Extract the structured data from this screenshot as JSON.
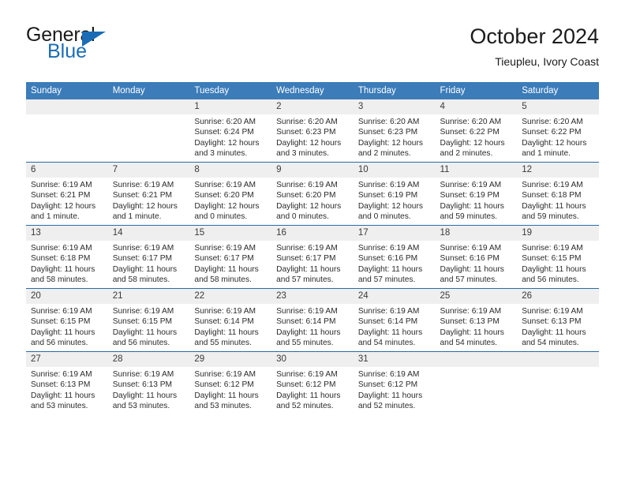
{
  "brand": {
    "name_top": "General",
    "name_bottom": "Blue",
    "color_top": "#1b1b1b",
    "color_bottom": "#1b6cb5",
    "triangle_icon": "triangle-icon"
  },
  "header": {
    "title": "October 2024",
    "subtitle": "Tieupleu, Ivory Coast"
  },
  "theme": {
    "header_bg": "#3b7cb9",
    "row_divider": "#2a6ba8",
    "daynum_bg": "#efefef",
    "text": "#2b2b2b"
  },
  "calendar": {
    "weekday_headers": [
      "Sunday",
      "Monday",
      "Tuesday",
      "Wednesday",
      "Thursday",
      "Friday",
      "Saturday"
    ],
    "weeks": [
      [
        {
          "day": "",
          "empty": true
        },
        {
          "day": "",
          "empty": true
        },
        {
          "day": "1",
          "sunrise": "Sunrise: 6:20 AM",
          "sunset": "Sunset: 6:24 PM",
          "daylight": "Daylight: 12 hours and 3 minutes."
        },
        {
          "day": "2",
          "sunrise": "Sunrise: 6:20 AM",
          "sunset": "Sunset: 6:23 PM",
          "daylight": "Daylight: 12 hours and 3 minutes."
        },
        {
          "day": "3",
          "sunrise": "Sunrise: 6:20 AM",
          "sunset": "Sunset: 6:23 PM",
          "daylight": "Daylight: 12 hours and 2 minutes."
        },
        {
          "day": "4",
          "sunrise": "Sunrise: 6:20 AM",
          "sunset": "Sunset: 6:22 PM",
          "daylight": "Daylight: 12 hours and 2 minutes."
        },
        {
          "day": "5",
          "sunrise": "Sunrise: 6:20 AM",
          "sunset": "Sunset: 6:22 PM",
          "daylight": "Daylight: 12 hours and 1 minute."
        }
      ],
      [
        {
          "day": "6",
          "sunrise": "Sunrise: 6:19 AM",
          "sunset": "Sunset: 6:21 PM",
          "daylight": "Daylight: 12 hours and 1 minute."
        },
        {
          "day": "7",
          "sunrise": "Sunrise: 6:19 AM",
          "sunset": "Sunset: 6:21 PM",
          "daylight": "Daylight: 12 hours and 1 minute."
        },
        {
          "day": "8",
          "sunrise": "Sunrise: 6:19 AM",
          "sunset": "Sunset: 6:20 PM",
          "daylight": "Daylight: 12 hours and 0 minutes."
        },
        {
          "day": "9",
          "sunrise": "Sunrise: 6:19 AM",
          "sunset": "Sunset: 6:20 PM",
          "daylight": "Daylight: 12 hours and 0 minutes."
        },
        {
          "day": "10",
          "sunrise": "Sunrise: 6:19 AM",
          "sunset": "Sunset: 6:19 PM",
          "daylight": "Daylight: 12 hours and 0 minutes."
        },
        {
          "day": "11",
          "sunrise": "Sunrise: 6:19 AM",
          "sunset": "Sunset: 6:19 PM",
          "daylight": "Daylight: 11 hours and 59 minutes."
        },
        {
          "day": "12",
          "sunrise": "Sunrise: 6:19 AM",
          "sunset": "Sunset: 6:18 PM",
          "daylight": "Daylight: 11 hours and 59 minutes."
        }
      ],
      [
        {
          "day": "13",
          "sunrise": "Sunrise: 6:19 AM",
          "sunset": "Sunset: 6:18 PM",
          "daylight": "Daylight: 11 hours and 58 minutes."
        },
        {
          "day": "14",
          "sunrise": "Sunrise: 6:19 AM",
          "sunset": "Sunset: 6:17 PM",
          "daylight": "Daylight: 11 hours and 58 minutes."
        },
        {
          "day": "15",
          "sunrise": "Sunrise: 6:19 AM",
          "sunset": "Sunset: 6:17 PM",
          "daylight": "Daylight: 11 hours and 58 minutes."
        },
        {
          "day": "16",
          "sunrise": "Sunrise: 6:19 AM",
          "sunset": "Sunset: 6:17 PM",
          "daylight": "Daylight: 11 hours and 57 minutes."
        },
        {
          "day": "17",
          "sunrise": "Sunrise: 6:19 AM",
          "sunset": "Sunset: 6:16 PM",
          "daylight": "Daylight: 11 hours and 57 minutes."
        },
        {
          "day": "18",
          "sunrise": "Sunrise: 6:19 AM",
          "sunset": "Sunset: 6:16 PM",
          "daylight": "Daylight: 11 hours and 57 minutes."
        },
        {
          "day": "19",
          "sunrise": "Sunrise: 6:19 AM",
          "sunset": "Sunset: 6:15 PM",
          "daylight": "Daylight: 11 hours and 56 minutes."
        }
      ],
      [
        {
          "day": "20",
          "sunrise": "Sunrise: 6:19 AM",
          "sunset": "Sunset: 6:15 PM",
          "daylight": "Daylight: 11 hours and 56 minutes."
        },
        {
          "day": "21",
          "sunrise": "Sunrise: 6:19 AM",
          "sunset": "Sunset: 6:15 PM",
          "daylight": "Daylight: 11 hours and 56 minutes."
        },
        {
          "day": "22",
          "sunrise": "Sunrise: 6:19 AM",
          "sunset": "Sunset: 6:14 PM",
          "daylight": "Daylight: 11 hours and 55 minutes."
        },
        {
          "day": "23",
          "sunrise": "Sunrise: 6:19 AM",
          "sunset": "Sunset: 6:14 PM",
          "daylight": "Daylight: 11 hours and 55 minutes."
        },
        {
          "day": "24",
          "sunrise": "Sunrise: 6:19 AM",
          "sunset": "Sunset: 6:14 PM",
          "daylight": "Daylight: 11 hours and 54 minutes."
        },
        {
          "day": "25",
          "sunrise": "Sunrise: 6:19 AM",
          "sunset": "Sunset: 6:13 PM",
          "daylight": "Daylight: 11 hours and 54 minutes."
        },
        {
          "day": "26",
          "sunrise": "Sunrise: 6:19 AM",
          "sunset": "Sunset: 6:13 PM",
          "daylight": "Daylight: 11 hours and 54 minutes."
        }
      ],
      [
        {
          "day": "27",
          "sunrise": "Sunrise: 6:19 AM",
          "sunset": "Sunset: 6:13 PM",
          "daylight": "Daylight: 11 hours and 53 minutes."
        },
        {
          "day": "28",
          "sunrise": "Sunrise: 6:19 AM",
          "sunset": "Sunset: 6:13 PM",
          "daylight": "Daylight: 11 hours and 53 minutes."
        },
        {
          "day": "29",
          "sunrise": "Sunrise: 6:19 AM",
          "sunset": "Sunset: 6:12 PM",
          "daylight": "Daylight: 11 hours and 53 minutes."
        },
        {
          "day": "30",
          "sunrise": "Sunrise: 6:19 AM",
          "sunset": "Sunset: 6:12 PM",
          "daylight": "Daylight: 11 hours and 52 minutes."
        },
        {
          "day": "31",
          "sunrise": "Sunrise: 6:19 AM",
          "sunset": "Sunset: 6:12 PM",
          "daylight": "Daylight: 11 hours and 52 minutes."
        },
        {
          "day": "",
          "empty": true
        },
        {
          "day": "",
          "empty": true
        }
      ]
    ]
  }
}
